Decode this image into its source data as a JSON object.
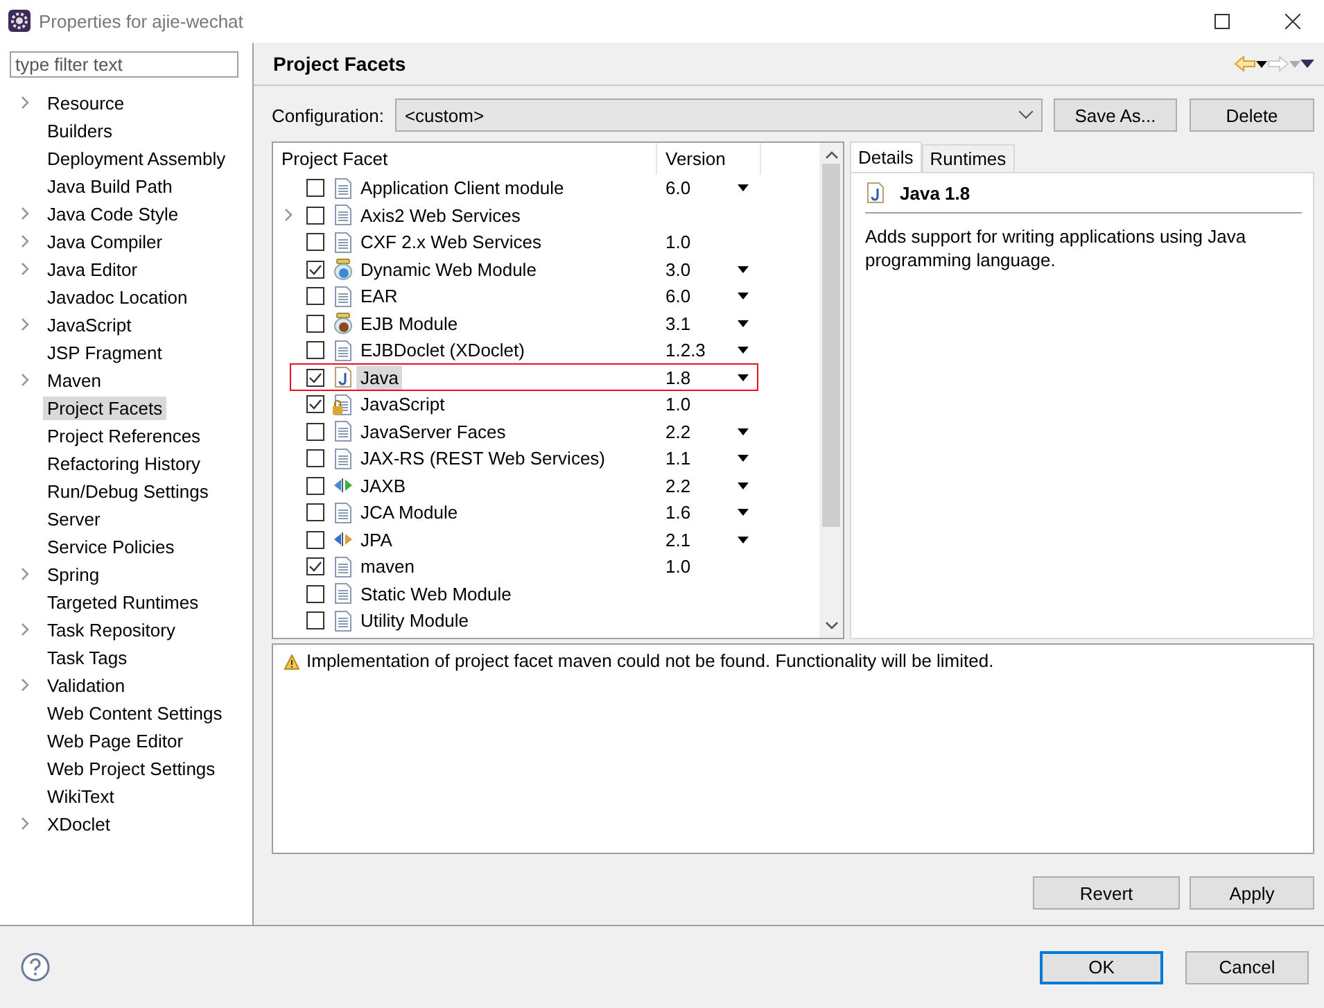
{
  "window": {
    "title": "Properties for ajie-wechat"
  },
  "filter": {
    "placeholder": "type filter text"
  },
  "sidebar": {
    "items": [
      {
        "label": "Resource",
        "expandable": true,
        "selected": false
      },
      {
        "label": "Builders",
        "expandable": false,
        "selected": false
      },
      {
        "label": "Deployment Assembly",
        "expandable": false,
        "selected": false
      },
      {
        "label": "Java Build Path",
        "expandable": false,
        "selected": false
      },
      {
        "label": "Java Code Style",
        "expandable": true,
        "selected": false
      },
      {
        "label": "Java Compiler",
        "expandable": true,
        "selected": false
      },
      {
        "label": "Java Editor",
        "expandable": true,
        "selected": false
      },
      {
        "label": "Javadoc Location",
        "expandable": false,
        "selected": false
      },
      {
        "label": "JavaScript",
        "expandable": true,
        "selected": false
      },
      {
        "label": "JSP Fragment",
        "expandable": false,
        "selected": false
      },
      {
        "label": "Maven",
        "expandable": true,
        "selected": false
      },
      {
        "label": "Project Facets",
        "expandable": false,
        "selected": true
      },
      {
        "label": "Project References",
        "expandable": false,
        "selected": false
      },
      {
        "label": "Refactoring History",
        "expandable": false,
        "selected": false
      },
      {
        "label": "Run/Debug Settings",
        "expandable": false,
        "selected": false
      },
      {
        "label": "Server",
        "expandable": false,
        "selected": false
      },
      {
        "label": "Service Policies",
        "expandable": false,
        "selected": false
      },
      {
        "label": "Spring",
        "expandable": true,
        "selected": false
      },
      {
        "label": "Targeted Runtimes",
        "expandable": false,
        "selected": false
      },
      {
        "label": "Task Repository",
        "expandable": true,
        "selected": false
      },
      {
        "label": "Task Tags",
        "expandable": false,
        "selected": false
      },
      {
        "label": "Validation",
        "expandable": true,
        "selected": false
      },
      {
        "label": "Web Content Settings",
        "expandable": false,
        "selected": false
      },
      {
        "label": "Web Page Editor",
        "expandable": false,
        "selected": false
      },
      {
        "label": "Web Project Settings",
        "expandable": false,
        "selected": false
      },
      {
        "label": "WikiText",
        "expandable": false,
        "selected": false
      },
      {
        "label": "XDoclet",
        "expandable": true,
        "selected": false
      }
    ]
  },
  "page": {
    "title": "Project Facets"
  },
  "configuration": {
    "label": "Configuration:",
    "value": "<custom>"
  },
  "config_buttons": [
    {
      "label": "Save As..."
    },
    {
      "label": "Delete"
    }
  ],
  "table": {
    "columns": [
      "Project Facet",
      "Version"
    ],
    "rows": [
      {
        "kind": "doc",
        "name": "Application Client module",
        "version": "6.0",
        "dropdown": true,
        "checked": false,
        "expandable": false,
        "selected": false
      },
      {
        "kind": "doc",
        "name": "Axis2 Web Services",
        "dropdown": false,
        "checked": false,
        "expandable": true,
        "selected": false
      },
      {
        "kind": "doc",
        "name": "CXF 2.x Web Services",
        "version": "1.0",
        "dropdown": false,
        "checked": false,
        "expandable": false,
        "selected": false
      },
      {
        "kind": "web",
        "name": "Dynamic Web Module",
        "version": "3.0",
        "dropdown": true,
        "checked": true,
        "expandable": false,
        "selected": false
      },
      {
        "kind": "doc",
        "name": "EAR",
        "version": "6.0",
        "dropdown": true,
        "checked": false,
        "expandable": false,
        "selected": false
      },
      {
        "kind": "ejb",
        "name": "EJB Module",
        "version": "3.1",
        "dropdown": true,
        "checked": false,
        "expandable": false,
        "selected": false
      },
      {
        "kind": "doc",
        "name": "EJBDoclet (XDoclet)",
        "version": "1.2.3",
        "dropdown": true,
        "checked": false,
        "expandable": false,
        "selected": false
      },
      {
        "kind": "java",
        "name": "Java",
        "version": "1.8",
        "dropdown": true,
        "checked": true,
        "expandable": false,
        "selected": true
      },
      {
        "kind": "locked",
        "name": "JavaScript",
        "version": "1.0",
        "dropdown": false,
        "checked": true,
        "expandable": false,
        "selected": false
      },
      {
        "kind": "doc",
        "name": "JavaServer Faces",
        "version": "2.2",
        "dropdown": true,
        "checked": false,
        "expandable": false,
        "selected": false
      },
      {
        "kind": "doc",
        "name": "JAX-RS (REST Web Services)",
        "version": "1.1",
        "dropdown": true,
        "checked": false,
        "expandable": false,
        "selected": false
      },
      {
        "kind": "jaxb",
        "name": "JAXB",
        "version": "2.2",
        "dropdown": true,
        "checked": false,
        "expandable": false,
        "selected": false
      },
      {
        "kind": "doc",
        "name": "JCA Module",
        "version": "1.6",
        "dropdown": true,
        "checked": false,
        "expandable": false,
        "selected": false
      },
      {
        "kind": "jpa",
        "name": "JPA",
        "version": "2.1",
        "dropdown": true,
        "checked": false,
        "expandable": false,
        "selected": false
      },
      {
        "kind": "doc",
        "name": "maven",
        "version": "1.0",
        "dropdown": false,
        "checked": true,
        "expandable": false,
        "selected": false
      },
      {
        "kind": "doc",
        "name": "Static Web Module",
        "dropdown": false,
        "checked": false,
        "expandable": false,
        "selected": false
      },
      {
        "kind": "doc",
        "name": "Utility Module",
        "dropdown": false,
        "checked": false,
        "expandable": false,
        "selected": false
      }
    ]
  },
  "details": {
    "tabs": [
      {
        "label": "Details",
        "selected": true
      },
      {
        "label": "Runtimes",
        "selected": false
      }
    ],
    "title": "Java 1.8",
    "description": "Adds support for writing applications using Java programming language."
  },
  "message": "Implementation of project facet maven could not be found. Functionality will be limited.",
  "page_buttons": [
    {
      "label": "Revert"
    },
    {
      "label": "Apply"
    }
  ],
  "dialog_buttons": [
    {
      "label": "OK",
      "default": true
    },
    {
      "label": "Cancel",
      "default": false
    }
  ]
}
